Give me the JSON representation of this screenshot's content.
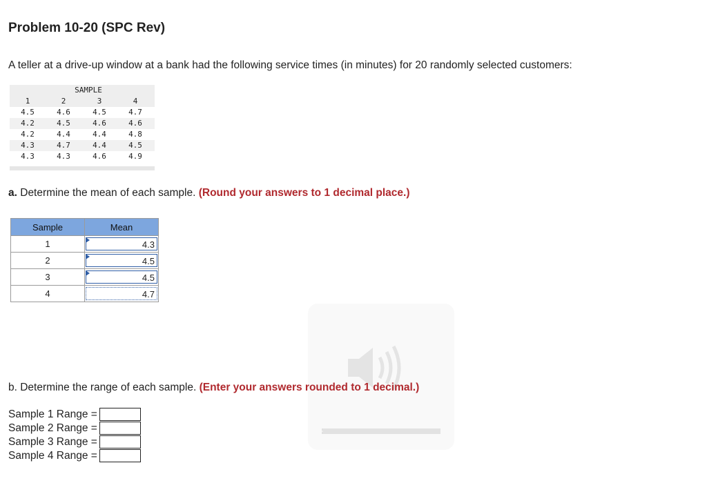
{
  "title": "Problem 10-20 (SPC Rev)",
  "intro": "A teller at a drive-up window at a bank had the following service times (in minutes) for 20 randomly selected customers:",
  "data_table": {
    "group_label": "SAMPLE",
    "columns": [
      "1",
      "2",
      "3",
      "4"
    ],
    "rows": [
      [
        "4.5",
        "4.6",
        "4.5",
        "4.7"
      ],
      [
        "4.2",
        "4.5",
        "4.6",
        "4.6"
      ],
      [
        "4.2",
        "4.4",
        "4.4",
        "4.8"
      ],
      [
        "4.3",
        "4.7",
        "4.4",
        "4.5"
      ],
      [
        "4.3",
        "4.3",
        "4.6",
        "4.9"
      ]
    ]
  },
  "part_a": {
    "lead": "a.",
    "text": " Determine the mean of each sample.",
    "note": "(Round your answers to 1 decimal place.)",
    "table": {
      "col_sample": "Sample",
      "col_mean": "Mean",
      "rows": [
        {
          "sample": "1",
          "mean": "4.3"
        },
        {
          "sample": "2",
          "mean": "4.5"
        },
        {
          "sample": "3",
          "mean": "4.5"
        },
        {
          "sample": "4",
          "mean": "4.7"
        }
      ]
    }
  },
  "part_b": {
    "text": "b. Determine the range of each sample.",
    "note": "(Enter your answers rounded to 1 decimal.)",
    "labels": [
      "Sample 1 Range =",
      "Sample 2 Range =",
      "Sample 3 Range =",
      "Sample 4 Range ="
    ],
    "values": [
      "",
      "",
      "",
      ""
    ]
  },
  "audio": {
    "icon": "speaker-icon",
    "progress": 0
  }
}
